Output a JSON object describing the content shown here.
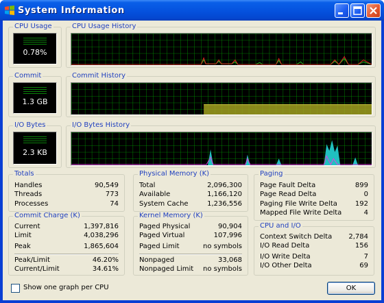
{
  "window": {
    "title": "System Information"
  },
  "meters": {
    "cpu": {
      "label": "CPU Usage",
      "value": "0.78%"
    },
    "commit": {
      "label": "Commit",
      "value": "1.3 GB"
    },
    "io": {
      "label": "I/O Bytes",
      "value": "2.3  KB"
    }
  },
  "histories": {
    "cpu": "CPU Usage History",
    "commit": "Commit History",
    "io": "I/O Bytes History"
  },
  "totals": {
    "title": "Totals",
    "rows": [
      {
        "k": "Handles",
        "v": "90,549"
      },
      {
        "k": "Threads",
        "v": "773"
      },
      {
        "k": "Processes",
        "v": "74"
      }
    ]
  },
  "commit_charge": {
    "title": "Commit Charge (K)",
    "rows": [
      {
        "k": "Current",
        "v": "1,397,816"
      },
      {
        "k": "Limit",
        "v": "4,038,296"
      },
      {
        "k": "Peak",
        "v": "1,865,604"
      },
      {
        "k": "Peak/Limit",
        "v": "46.20%"
      },
      {
        "k": "Current/Limit",
        "v": "34.61%"
      }
    ]
  },
  "physical_memory": {
    "title": "Physical Memory (K)",
    "rows": [
      {
        "k": "Total",
        "v": "2,096,300"
      },
      {
        "k": "Available",
        "v": "1,166,120"
      },
      {
        "k": "System Cache",
        "v": "1,236,556"
      }
    ]
  },
  "kernel_memory": {
    "title": "Kernel Memory (K)",
    "rows": [
      {
        "k": "Paged Physical",
        "v": "90,904"
      },
      {
        "k": "Paged Virtual",
        "v": "107,996"
      },
      {
        "k": "Paged Limit",
        "v": "no symbols"
      },
      {
        "k": "Nonpaged",
        "v": "33,068"
      },
      {
        "k": "Nonpaged Limit",
        "v": "no symbols"
      }
    ]
  },
  "paging": {
    "title": "Paging",
    "rows": [
      {
        "k": "Page Fault Delta",
        "v": "899"
      },
      {
        "k": "Page Read Delta",
        "v": "0"
      },
      {
        "k": "Paging File Write Delta",
        "v": "192"
      },
      {
        "k": "Mapped File Write Delta",
        "v": "4"
      }
    ]
  },
  "cpu_io": {
    "title": "CPU and I/O",
    "rows": [
      {
        "k": "Context Switch Delta",
        "v": "2,784"
      },
      {
        "k": "I/O Read Delta",
        "v": "156"
      },
      {
        "k": "I/O Write Delta",
        "v": "7"
      },
      {
        "k": "I/O Other Delta",
        "v": "69"
      }
    ]
  },
  "footer": {
    "checkbox_label": "Show one graph per CPU",
    "checked": false,
    "ok_label": "OK"
  },
  "colors": {
    "grid": "#00a000",
    "cpu_kernel": "#e02020",
    "cpu_user": "#20c020",
    "commit": "#a0a020",
    "io_other": "#20c0c0",
    "io_read": "#e040e0"
  }
}
